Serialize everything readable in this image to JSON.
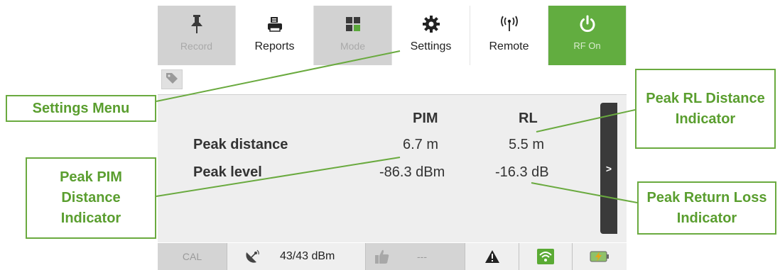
{
  "toolbar": {
    "items": [
      {
        "label": "Record",
        "icon": "pin-icon",
        "state": "disabled"
      },
      {
        "label": "Reports",
        "icon": "printer-icon",
        "state": "normal"
      },
      {
        "label": "Mode",
        "icon": "grid-icon",
        "state": "disabled"
      },
      {
        "label": "Settings",
        "icon": "gear-icon",
        "state": "normal"
      },
      {
        "label": "Remote",
        "icon": "antenna-icon",
        "state": "normal"
      },
      {
        "label": "RF On",
        "icon": "power-icon",
        "state": "active"
      }
    ]
  },
  "results": {
    "col_pim": "PIM",
    "col_rl": "RL",
    "row_distance": "Peak distance",
    "row_level": "Peak level",
    "pim_distance": "6.7 m",
    "rl_distance": "5.5 m",
    "pim_level": "-86.3 dBm",
    "rl_level": "-16.3 dB",
    "expand_label": ">"
  },
  "status": {
    "cal": "CAL",
    "power": "43/43 dBm",
    "placeholder": "---"
  },
  "annotations": {
    "settings_menu": "Settings Menu",
    "peak_rl_distance": "Peak RL Distance Indicator",
    "peak_pim_distance": "Peak PIM Distance Indicator",
    "peak_return_loss": "Peak Return Loss Indicator"
  },
  "colors": {
    "accent_green": "#62ad40",
    "annotation_green": "#6aaa3f",
    "disabled_gray": "#d2d2d2"
  }
}
